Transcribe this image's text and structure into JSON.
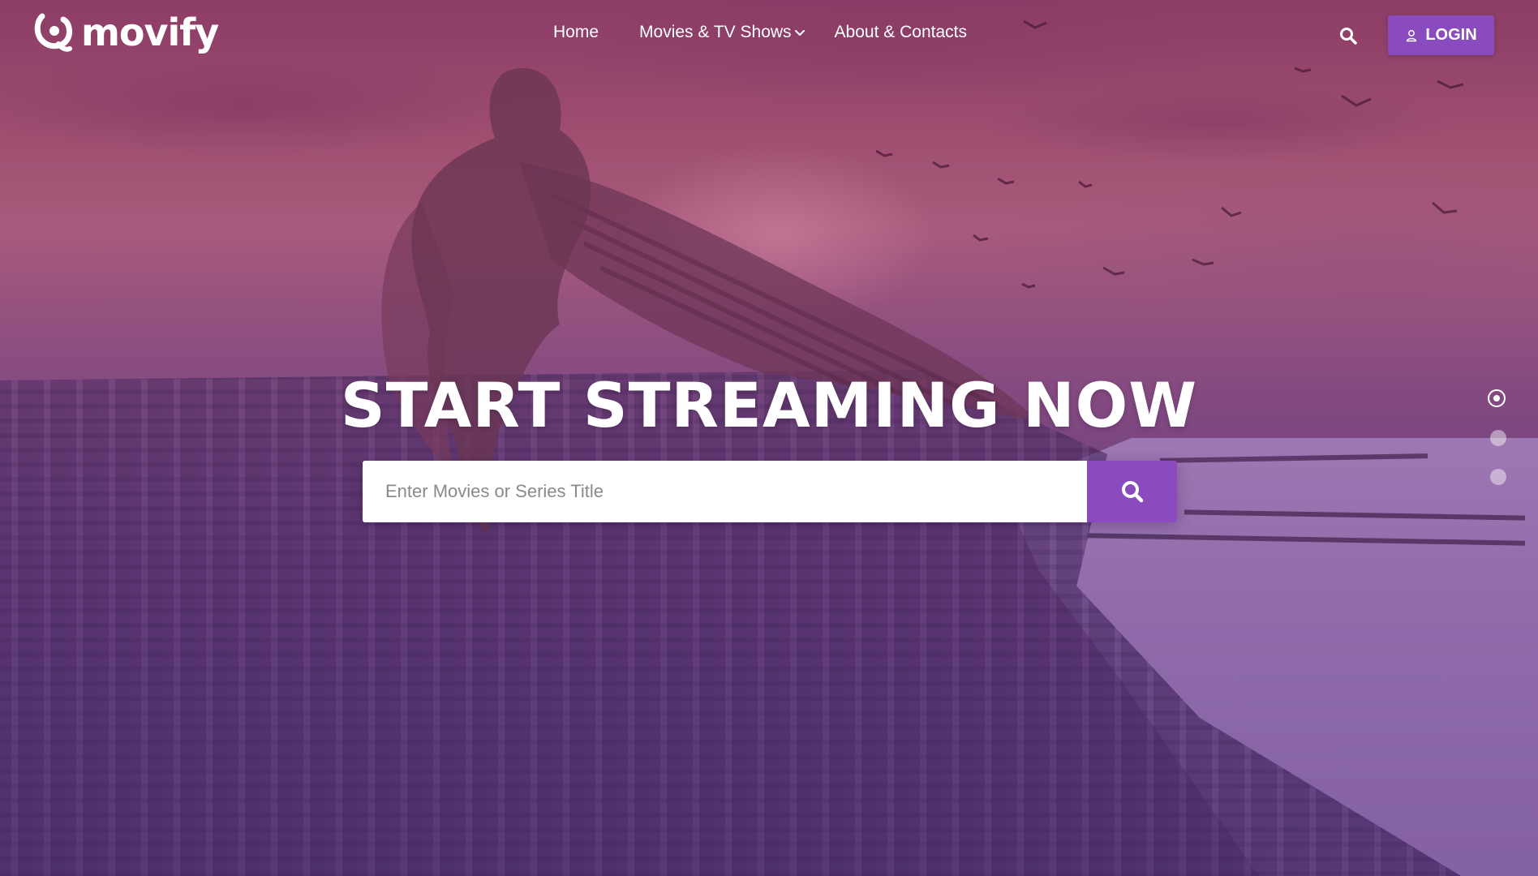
{
  "brand": {
    "name": "movify",
    "accent_color": "#8a4bbf"
  },
  "nav": {
    "items": [
      {
        "label": "Home"
      },
      {
        "label": "Movies & TV Shows",
        "has_dropdown": true
      },
      {
        "label": "About & Contacts"
      }
    ]
  },
  "header": {
    "search_icon": "search-icon",
    "login_label": "LOGIN",
    "login_icon": "user-icon"
  },
  "hero": {
    "title": "START STREAMING NOW",
    "search": {
      "placeholder": "Enter Movies or Series Title",
      "value": "",
      "button_icon": "search-icon"
    },
    "slider": {
      "count": 3,
      "active_index": 0
    }
  }
}
